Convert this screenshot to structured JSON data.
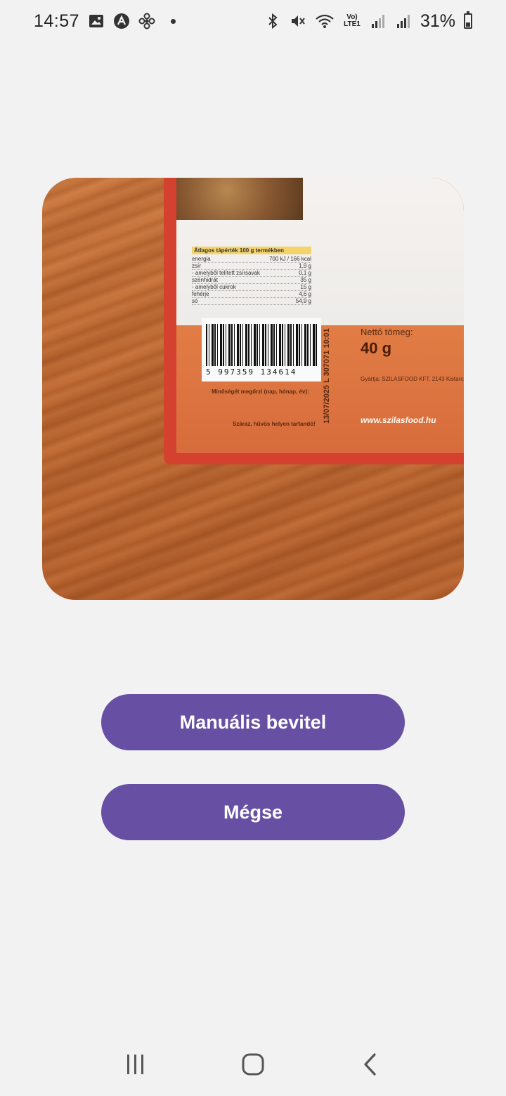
{
  "status_bar": {
    "time": "14:57",
    "battery_percent": "31%",
    "battery_level": 0.31,
    "lte_label": "Vo) LTE1",
    "icons": [
      "gallery-icon",
      "app-a-icon",
      "fan-icon",
      "notification-dot",
      "bluetooth-icon",
      "mute-icon",
      "wifi-icon",
      "lte-icon",
      "signal-icon",
      "signal-icon",
      "battery-icon"
    ]
  },
  "photo": {
    "nutrition_title": "Átlagos tápérték 100 g termékben",
    "nutrition_rows": [
      {
        "label": "energia",
        "value": "700 kJ / 166 kcal"
      },
      {
        "label": "zsír",
        "value": "1,9 g"
      },
      {
        "label": "- amelyből telített zsírsavak",
        "value": "0,1 g"
      },
      {
        "label": "szénhidrát",
        "value": "35 g"
      },
      {
        "label": "- amelyből cukrok",
        "value": "15 g"
      },
      {
        "label": "fehérje",
        "value": "4,6 g"
      },
      {
        "label": "só",
        "value": "54,9 g"
      }
    ],
    "barcode_number": "5 997359 134614",
    "best_before": "Minőségét megőrzi (nap, hónap, év):",
    "storage": "Száraz, hűvös helyen tartandó!",
    "lot": "13/07/2025 L 307071 10:01",
    "netto_label": "Nettó tömeg:",
    "netto_value": "40 g",
    "maker": "Gyártja: SZILASFOOD KFT. 2143 Kistarcsa",
    "website": "www.szilasfood.hu"
  },
  "buttons": {
    "manual_entry": "Manuális bevitel",
    "cancel": "Mégse"
  },
  "colors": {
    "accent": "#6750a4",
    "background": "#f2f2f2"
  },
  "nav": [
    "recent-apps-icon",
    "home-icon",
    "back-icon"
  ]
}
